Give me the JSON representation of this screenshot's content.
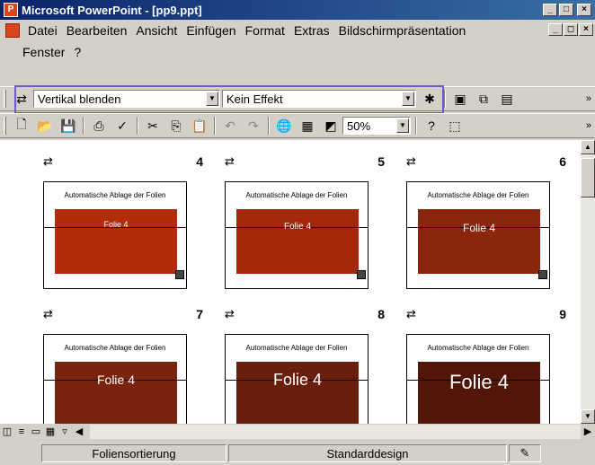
{
  "window": {
    "title": "Microsoft PowerPoint - [pp9.ppt]",
    "app_icon": "powerpoint-icon"
  },
  "menu": {
    "row1": [
      "Datei",
      "Bearbeiten",
      "Ansicht",
      "Einfügen",
      "Format",
      "Extras",
      "Bildschirmpräsentation"
    ],
    "row2": [
      "Fenster",
      "?"
    ]
  },
  "toolbar_transition": {
    "transition_value": "Vertikal blenden",
    "effect_value": "Kein Effekt"
  },
  "toolbar_standard": {
    "zoom_value": "50%"
  },
  "slides": [
    {
      "number": "4",
      "title": "Automatische Ablage der Folien",
      "label": "Folie 4",
      "color": "#b22c0a"
    },
    {
      "number": "5",
      "title": "Automatische Ablage der Folien",
      "label": "Folie 4",
      "color": "#a22a0a"
    },
    {
      "number": "6",
      "title": "Automatische Ablage der Folien",
      "label": "Folie 4",
      "color": "#8a260c"
    },
    {
      "number": "7",
      "title": "Automatische Ablage der Folien",
      "label": "Folie 4",
      "color": "#7a230e"
    },
    {
      "number": "8",
      "title": "Automatische Ablage der Folien",
      "label": "Folie 4",
      "color": "#6a1e0c"
    },
    {
      "number": "9",
      "title": "Automatische Ablage der Folien",
      "label": "Folie 4",
      "color": "#521607"
    }
  ],
  "status": {
    "view": "Foliensortierung",
    "design": "Standarddesign"
  }
}
